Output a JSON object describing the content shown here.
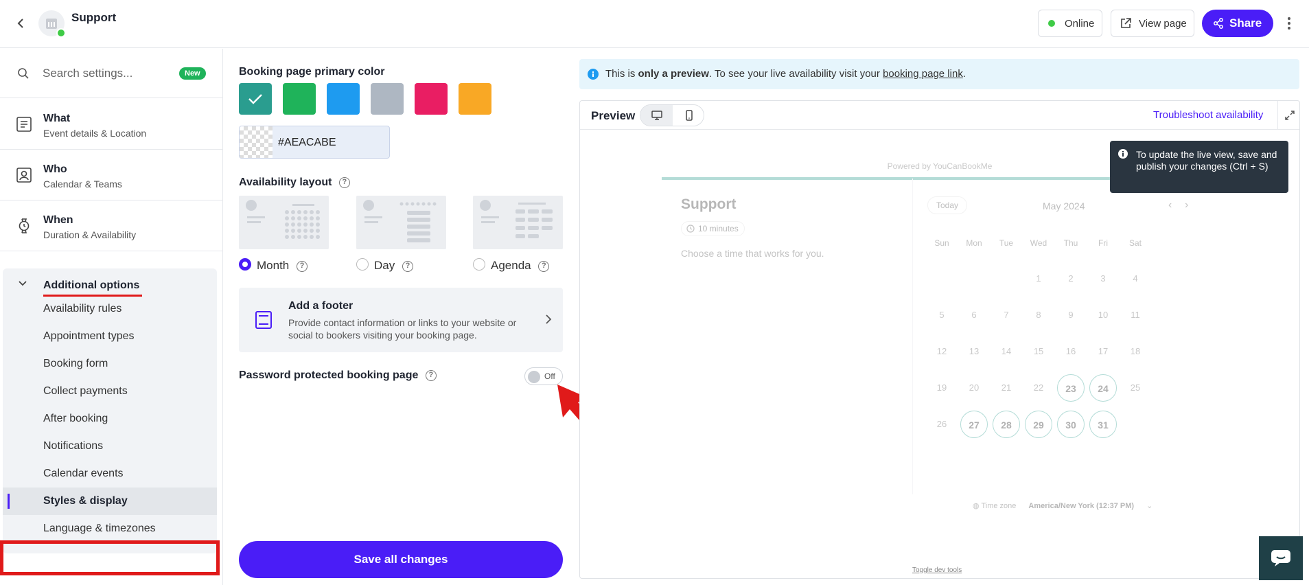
{
  "header": {
    "page_title": "Support",
    "status_label": "Online",
    "view_page_label": "View page",
    "share_label": "Share"
  },
  "sidebar": {
    "search_placeholder": "Search settings...",
    "new_badge": "New",
    "items": [
      {
        "title": "What",
        "subtitle": "Event details & Location"
      },
      {
        "title": "Who",
        "subtitle": "Calendar & Teams"
      },
      {
        "title": "When",
        "subtitle": "Duration & Availability"
      }
    ],
    "additional": {
      "title": "Additional options",
      "items": [
        "Availability rules",
        "Appointment types",
        "Booking form",
        "Collect payments",
        "After booking",
        "Notifications",
        "Calendar events",
        "Styles & display",
        "Language & timezones"
      ],
      "active_item": "Styles & display"
    }
  },
  "settings": {
    "primary_color_label": "Booking page primary color",
    "swatches": [
      "#2a9d8f",
      "#1fb35a",
      "#1e9bf0",
      "#aeacbe",
      "#e91e63",
      "#f9a825"
    ],
    "selected_swatch": "#2a9d8f",
    "hex_value": "#AEACABE",
    "availability_layout_label": "Availability layout",
    "layouts": [
      {
        "label": "Month",
        "checked": true
      },
      {
        "label": "Day",
        "checked": false
      },
      {
        "label": "Agenda",
        "checked": false
      }
    ],
    "footer_card": {
      "title": "Add a footer",
      "description": "Provide contact information or links to your website or social to bookers visiting your booking page."
    },
    "password_label": "Password protected booking page",
    "password_toggle": "Off",
    "save_label": "Save all changes"
  },
  "preview": {
    "banner_prefix": "This is ",
    "banner_bold": "only a preview",
    "banner_middle": ". To see your live availability visit your ",
    "banner_link": "booking page link",
    "banner_suffix": ".",
    "title": "Preview",
    "troubleshoot_label": "Troubleshoot availability",
    "tooltip": "To update the live view, save and publish your changes (Ctrl + S)",
    "toggle_dev_tools": "Toggle dev tools",
    "booking": {
      "powered_by": "Powered by YouCanBookMe",
      "title": "Support",
      "duration": "10 minutes",
      "choose_text": "Choose a time that works for you.",
      "today_label": "Today",
      "month_label": "May 2024",
      "days_of_week": [
        "Sun",
        "Mon",
        "Tue",
        "Wed",
        "Thu",
        "Fri",
        "Sat"
      ],
      "weeks": [
        [
          "",
          "",
          "",
          "1",
          "2",
          "3",
          "4"
        ],
        [
          "5",
          "6",
          "7",
          "8",
          "9",
          "10",
          "11"
        ],
        [
          "12",
          "13",
          "14",
          "15",
          "16",
          "17",
          "18"
        ],
        [
          "19",
          "20",
          "21",
          "22",
          "23",
          "24",
          "25"
        ],
        [
          "26",
          "27",
          "28",
          "29",
          "30",
          "31",
          ""
        ]
      ],
      "available_days": [
        "23",
        "24",
        "27",
        "28",
        "29",
        "30",
        "31"
      ],
      "timezone_label": "Time zone",
      "timezone_value": "America/New York (12:37 PM)"
    }
  }
}
